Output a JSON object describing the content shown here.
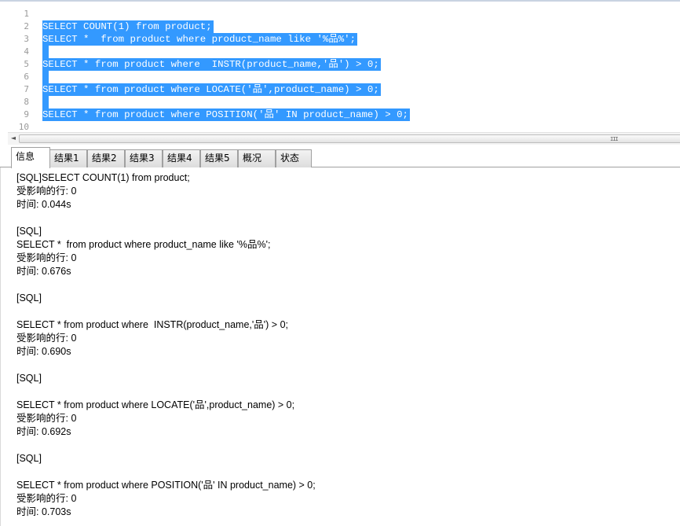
{
  "editor": {
    "lines": [
      {
        "num": "1",
        "text": ""
      },
      {
        "num": "2",
        "text": "SELECT COUNT(1) from product;"
      },
      {
        "num": "3",
        "text": "SELECT *  from product where product_name like '%品%';"
      },
      {
        "num": "4",
        "text": ""
      },
      {
        "num": "5",
        "text": "SELECT * from product where  INSTR(product_name,'品') > 0;"
      },
      {
        "num": "6",
        "text": ""
      },
      {
        "num": "7",
        "text": "SELECT * from product where LOCATE('品',product_name) > 0;"
      },
      {
        "num": "8",
        "text": ""
      },
      {
        "num": "9",
        "text": "SELECT * from product where POSITION('品' IN product_name) > 0;"
      },
      {
        "num": "10",
        "text": ""
      }
    ],
    "selection_color": "#3399ff"
  },
  "scrollbar": {
    "left_arrow": "◄",
    "grip": "III"
  },
  "tabs": [
    {
      "label": "信息"
    },
    {
      "label": "结果1"
    },
    {
      "label": "结果2"
    },
    {
      "label": "结果3"
    },
    {
      "label": "结果4"
    },
    {
      "label": "结果5"
    },
    {
      "label": "概况"
    },
    {
      "label": "状态"
    }
  ],
  "output": {
    "lines": [
      "[SQL]SELECT COUNT(1) from product;",
      "受影响的行: 0",
      "时间: 0.044s",
      "",
      "[SQL]",
      "SELECT *  from product where product_name like '%品%';",
      "受影响的行: 0",
      "时间: 0.676s",
      "",
      "[SQL]",
      "",
      "SELECT * from product where  INSTR(product_name,'品') > 0;",
      "受影响的行: 0",
      "时间: 0.690s",
      "",
      "[SQL]",
      "",
      "SELECT * from product where LOCATE('品',product_name) > 0;",
      "受影响的行: 0",
      "时间: 0.692s",
      "",
      "[SQL]",
      "",
      "SELECT * from product where POSITION('品' IN product_name) > 0;",
      "受影响的行: 0",
      "时间: 0.703s"
    ]
  }
}
